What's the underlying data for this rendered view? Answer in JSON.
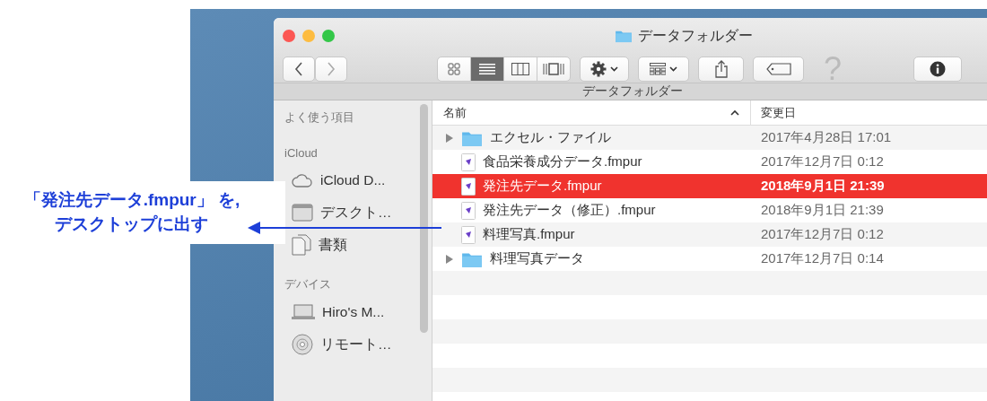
{
  "annotation": {
    "lines": [
      "「発注先データ.fmpur」 を,",
      "デスクトップに出す"
    ]
  },
  "window": {
    "title": "データフォルダー"
  },
  "toolbar": {
    "view_modes": [
      {
        "kind": "icons",
        "selected": false
      },
      {
        "kind": "list",
        "selected": true
      },
      {
        "kind": "columns",
        "selected": false
      },
      {
        "kind": "gallery",
        "selected": false
      }
    ],
    "help": "?"
  },
  "path_bar": {
    "title": "データフォルダー"
  },
  "sidebar": {
    "sections": [
      {
        "title": "よく使う項目"
      },
      {
        "title": "iCloud",
        "items": [
          {
            "kind": "cloud",
            "label": "iCloud D..."
          },
          {
            "kind": "desktop",
            "label": "デスクト…"
          },
          {
            "kind": "documents",
            "label": "書類"
          }
        ]
      },
      {
        "title": "デバイス",
        "items": [
          {
            "kind": "laptop",
            "label": "Hiro's M..."
          },
          {
            "kind": "disc",
            "label": "リモート…"
          }
        ]
      }
    ]
  },
  "table": {
    "columns": [
      {
        "label": "名前",
        "sorted": true
      },
      {
        "label": "変更日",
        "sorted": false
      }
    ],
    "rows": [
      {
        "kind": "folder",
        "name": "エクセル・ファイル",
        "date": "2017年4月28日 17:01",
        "expanded": false,
        "selected": false
      },
      {
        "kind": "file",
        "name": "食品栄養成分データ.fmpur",
        "date": "2017年12月7日 0:12",
        "selected": false
      },
      {
        "kind": "file",
        "name": "発注先データ.fmpur",
        "date": "2018年9月1日 21:39",
        "selected": true
      },
      {
        "kind": "file",
        "name": "発注先データ（修正）.fmpur",
        "date": "2018年9月1日 21:39",
        "selected": false
      },
      {
        "kind": "file",
        "name": "料理写真.fmpur",
        "date": "2017年12月7日 0:12",
        "selected": false
      },
      {
        "kind": "folder",
        "name": "料理写真データ",
        "date": "2017年12月7日 0:14",
        "expanded": false,
        "selected": false
      }
    ]
  }
}
